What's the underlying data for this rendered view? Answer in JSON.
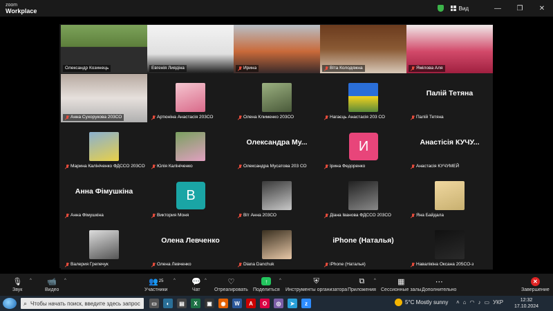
{
  "titlebar": {
    "logo_line1": "zoom",
    "logo_line2": "Workplace",
    "view_label": "Вид",
    "minimize": "—",
    "maximize": "❐",
    "close": "✕"
  },
  "tiles": [
    {
      "name": "Олександр Козинець",
      "type": "video",
      "muted": false,
      "active": true
    },
    {
      "name": "Евгенія Лиядіна",
      "type": "video",
      "muted": false
    },
    {
      "name": "Ирина",
      "type": "video",
      "muted": true
    },
    {
      "name": "Віта Колодяжна",
      "type": "video",
      "muted": true
    },
    {
      "name": "Ямілова Аля",
      "type": "video",
      "muted": true
    },
    {
      "name": "Анна Сухорукова 203СО",
      "type": "video",
      "muted": true
    },
    {
      "name": "Артюніна Анастасія 203СО",
      "type": "thumb",
      "muted": true
    },
    {
      "name": "Олена Клименко 203СО",
      "type": "thumb",
      "muted": true
    },
    {
      "name": "Нагаєць Анастасія 203 СО",
      "type": "thumb",
      "muted": true
    },
    {
      "name": "Палій Тетяна",
      "type": "text",
      "big": "Палій Тетяна",
      "muted": true
    },
    {
      "name": "Марина Калініченко ФДССО 203СО",
      "type": "thumb",
      "muted": true
    },
    {
      "name": "Юлія Калініченко",
      "type": "thumb",
      "muted": true
    },
    {
      "name": "Олександра Мусатова 203 СО",
      "type": "text",
      "big": "Олександра Му...",
      "muted": true
    },
    {
      "name": "Ірина Федоренко",
      "type": "letter",
      "letter": "И",
      "color": "#e8457a",
      "muted": true
    },
    {
      "name": "Анастасія КУЧУМЕЙ",
      "type": "text",
      "big": "Анастісія КУЧУ...",
      "muted": true
    },
    {
      "name": "Анна Фімушкіна",
      "type": "text",
      "big": "Анна Фімушкіна",
      "muted": true
    },
    {
      "name": "Виктория Моня",
      "type": "letter",
      "letter": "В",
      "color": "#1aa5a5",
      "muted": true
    },
    {
      "name": "Віт Анна 203СО",
      "type": "thumb",
      "muted": true
    },
    {
      "name": "Діана Іванова ФДССО 203СО",
      "type": "thumb",
      "muted": true
    },
    {
      "name": "Яна Байдала",
      "type": "thumb",
      "muted": true
    },
    {
      "name": "Валерия Грепечук",
      "type": "thumb",
      "muted": true
    },
    {
      "name": "Олена Левченко",
      "type": "text",
      "big": "Олена Левченко",
      "muted": true
    },
    {
      "name": "Diana Danchuk",
      "type": "thumb",
      "muted": true
    },
    {
      "name": "iPhone (Наталья)",
      "type": "text",
      "big": "iPhone (Наталья)",
      "muted": true
    },
    {
      "name": "Навалікіна Оксана 205СО-з",
      "type": "thumb",
      "muted": true
    }
  ],
  "toolbar": {
    "audio": "Звук",
    "video": "Видео",
    "participants": "Участники",
    "participants_count": "25",
    "chat": "Чат",
    "react": "Отреагировать",
    "share": "Поделиться",
    "host_tools": "Инструменты организатора",
    "apps": "Приложения",
    "breakout": "Сессионные залы",
    "more": "Дополнительно",
    "end": "Завершение"
  },
  "taskbar": {
    "search_placeholder": "Чтобы начать поиск, введите здесь запрос",
    "weather": "5°C  Mostly sunny",
    "lang": "УКР",
    "time": "12:32",
    "date": "17.10.2024"
  },
  "colors": {
    "active_border": "#2ecc71",
    "muted_icon": "#e74c3c",
    "share_green": "#23c55e",
    "end_red": "#e02424"
  }
}
